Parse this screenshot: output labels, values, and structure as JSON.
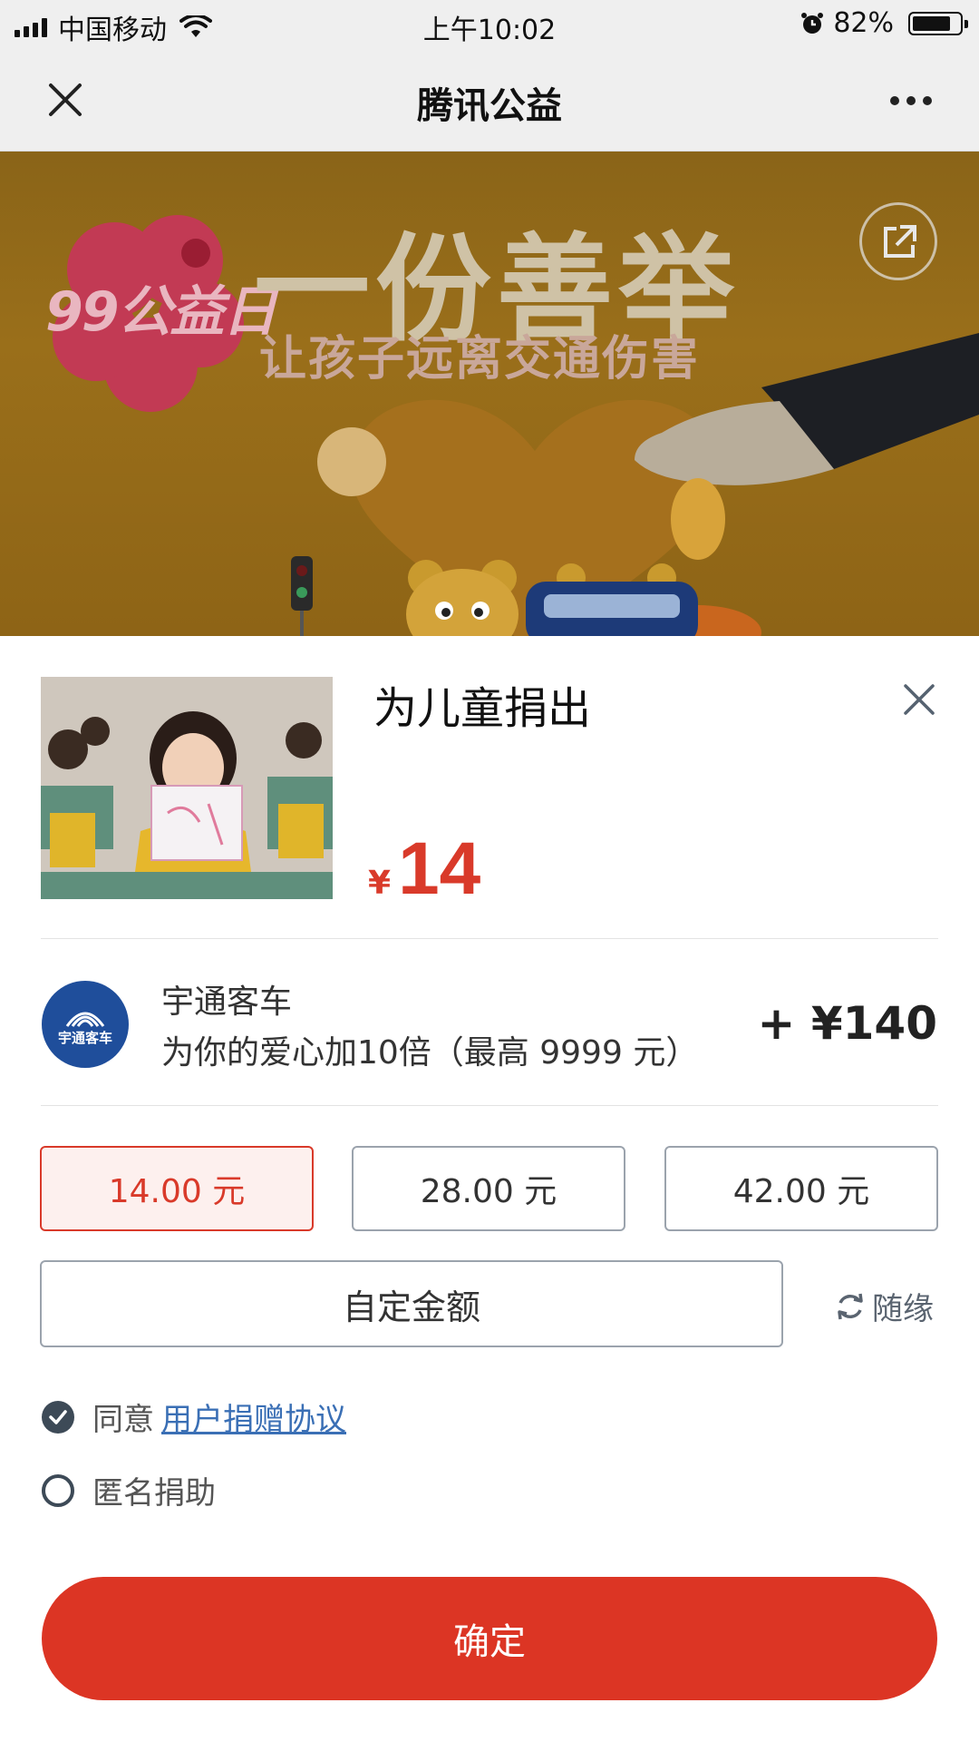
{
  "status_bar": {
    "carrier": "中国移动",
    "time": "上午10:02",
    "battery": "82%",
    "battery_level": 0.82
  },
  "nav": {
    "title": "腾讯公益",
    "close_icon": "close-icon",
    "more_icon": "more-icon"
  },
  "banner": {
    "badge": "99公益日",
    "headline": "一份善举",
    "subline": "让孩子远离交通伤害"
  },
  "donation": {
    "title": "为儿童捐出",
    "currency": "¥",
    "amount": "14",
    "sponsor": {
      "name": "宇通客车",
      "logo_text": "宇通客车",
      "description": "为你的爱心加10倍（最高 9999 元）",
      "bonus": "+ ¥140"
    },
    "options": [
      {
        "label": "14.00 元",
        "selected": true
      },
      {
        "label": "28.00 元",
        "selected": false
      },
      {
        "label": "42.00 元",
        "selected": false
      }
    ],
    "custom_label": "自定金额",
    "random_label": "随缘",
    "agree_prefix": "同意",
    "agree_link": "用户捐赠协议",
    "anonymous_label": "匿名捐助",
    "confirm_label": "确定"
  },
  "colors": {
    "accent_red": "#dc3524",
    "link_blue": "#3a6fb5",
    "sponsor_blue": "#1f4e9b"
  }
}
